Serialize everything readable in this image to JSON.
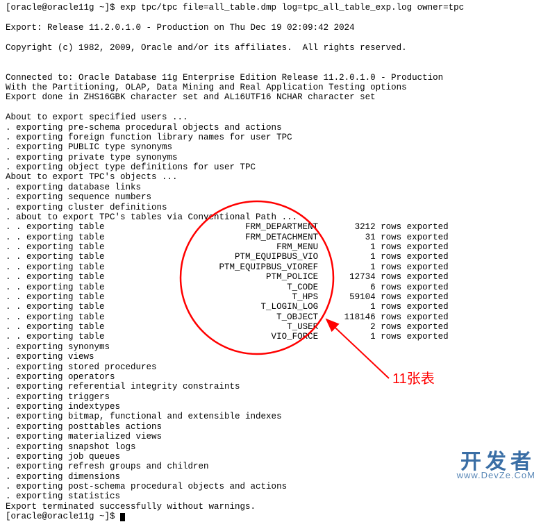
{
  "prompt_line": "[oracle@oracle11g ~]$ exp tpc/tpc file=all_table.dmp log=tpc_all_table_exp.log owner=tpc",
  "header1": "Export: Release 11.2.0.1.0 - Production on Thu Dec 19 02:09:42 2024",
  "header2": "Copyright (c) 1982, 2009, Oracle and/or its affiliates.  All rights reserved.",
  "conn1": "Connected to: Oracle Database 11g Enterprise Edition Release 11.2.0.1.0 - Production",
  "conn2": "With the Partitioning, OLAP, Data Mining and Real Application Testing options",
  "conn3": "Export done in ZHS16GBK character set and AL16UTF16 NCHAR character set",
  "pre": [
    "About to export specified users ...",
    ". exporting pre-schema procedural objects and actions",
    ". exporting foreign function library names for user TPC",
    ". exporting PUBLIC type synonyms",
    ". exporting private type synonyms",
    ". exporting object type definitions for user TPC",
    "About to export TPC's objects ...",
    ". exporting database links",
    ". exporting sequence numbers",
    ". exporting cluster definitions",
    ". about to export TPC's tables via Conventional Path ..."
  ],
  "tables": [
    {
      "name": "FRM_DEPARTMENT",
      "rows": 3212
    },
    {
      "name": "FRM_DETACHMENT",
      "rows": 31
    },
    {
      "name": "FRM_MENU",
      "rows": 1
    },
    {
      "name": "PTM_EQUIPBUS_VIO",
      "rows": 1
    },
    {
      "name": "PTM_EQUIPBUS_VIOREF",
      "rows": 1
    },
    {
      "name": "PTM_POLICE",
      "rows": 12734
    },
    {
      "name": "T_CODE",
      "rows": 6
    },
    {
      "name": "T_HPS",
      "rows": 59104
    },
    {
      "name": "T_LOGIN_LOG",
      "rows": 1
    },
    {
      "name": "T_OBJECT",
      "rows": 118146
    },
    {
      "name": "T_USER",
      "rows": 2
    },
    {
      "name": "VIO_FORCE",
      "rows": 1
    }
  ],
  "post": [
    ". exporting synonyms",
    ". exporting views",
    ". exporting stored procedures",
    ". exporting operators",
    ". exporting referential integrity constraints",
    ". exporting triggers",
    ". exporting indextypes",
    ". exporting bitmap, functional and extensible indexes",
    ". exporting posttables actions",
    ". exporting materialized views",
    ". exporting snapshot logs",
    ". exporting job queues",
    ". exporting refresh groups and children",
    ". exporting dimensions",
    ". exporting post-schema procedural objects and actions",
    ". exporting statistics"
  ],
  "done": "Export terminated successfully without warnings.",
  "final_prompt": "[oracle@oracle11g ~]$ ",
  "annotation": "11张表",
  "watermark_top": "开发者",
  "watermark_bottom": "www.DevZe.CoM",
  "chart_data": {
    "type": "table",
    "title": "Oracle exp table export rows",
    "columns": [
      "table",
      "rows_exported"
    ],
    "rows": [
      [
        "FRM_DEPARTMENT",
        3212
      ],
      [
        "FRM_DETACHMENT",
        31
      ],
      [
        "FRM_MENU",
        1
      ],
      [
        "PTM_EQUIPBUS_VIO",
        1
      ],
      [
        "PTM_EQUIPBUS_VIOREF",
        1
      ],
      [
        "PTM_POLICE",
        12734
      ],
      [
        "T_CODE",
        6
      ],
      [
        "T_HPS",
        59104
      ],
      [
        "T_LOGIN_LOG",
        1
      ],
      [
        "T_OBJECT",
        118146
      ],
      [
        "T_USER",
        2
      ],
      [
        "VIO_FORCE",
        1
      ]
    ]
  }
}
